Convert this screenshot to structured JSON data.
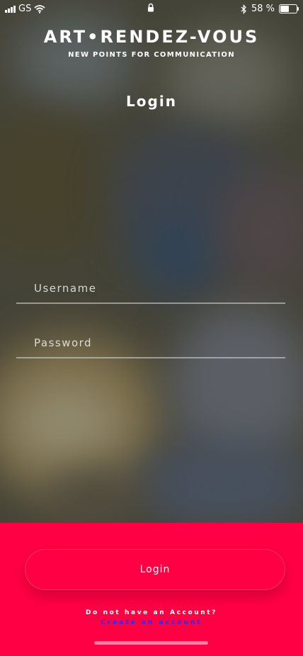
{
  "status_bar": {
    "carrier": "GS",
    "battery_text": "58 %",
    "battery_level": 0.58,
    "icons": [
      "signal-bars-icon",
      "wifi-icon",
      "lock-icon",
      "bluetooth-icon",
      "battery-icon"
    ]
  },
  "brand": {
    "name": "ART•RENDEZ-VOUS",
    "tagline": "NEW POINTS FOR COMMUNICATION"
  },
  "page_title": "Login",
  "form": {
    "username_placeholder": "Username",
    "username_value": "",
    "password_placeholder": "Password",
    "password_value": ""
  },
  "actions": {
    "login_label": "Login",
    "no_account_text": "Do not have an Account?",
    "create_account_label": "Create an account"
  },
  "colors": {
    "accent": "#ff0044",
    "link": "#2a2aff",
    "text": "#ffffff"
  }
}
